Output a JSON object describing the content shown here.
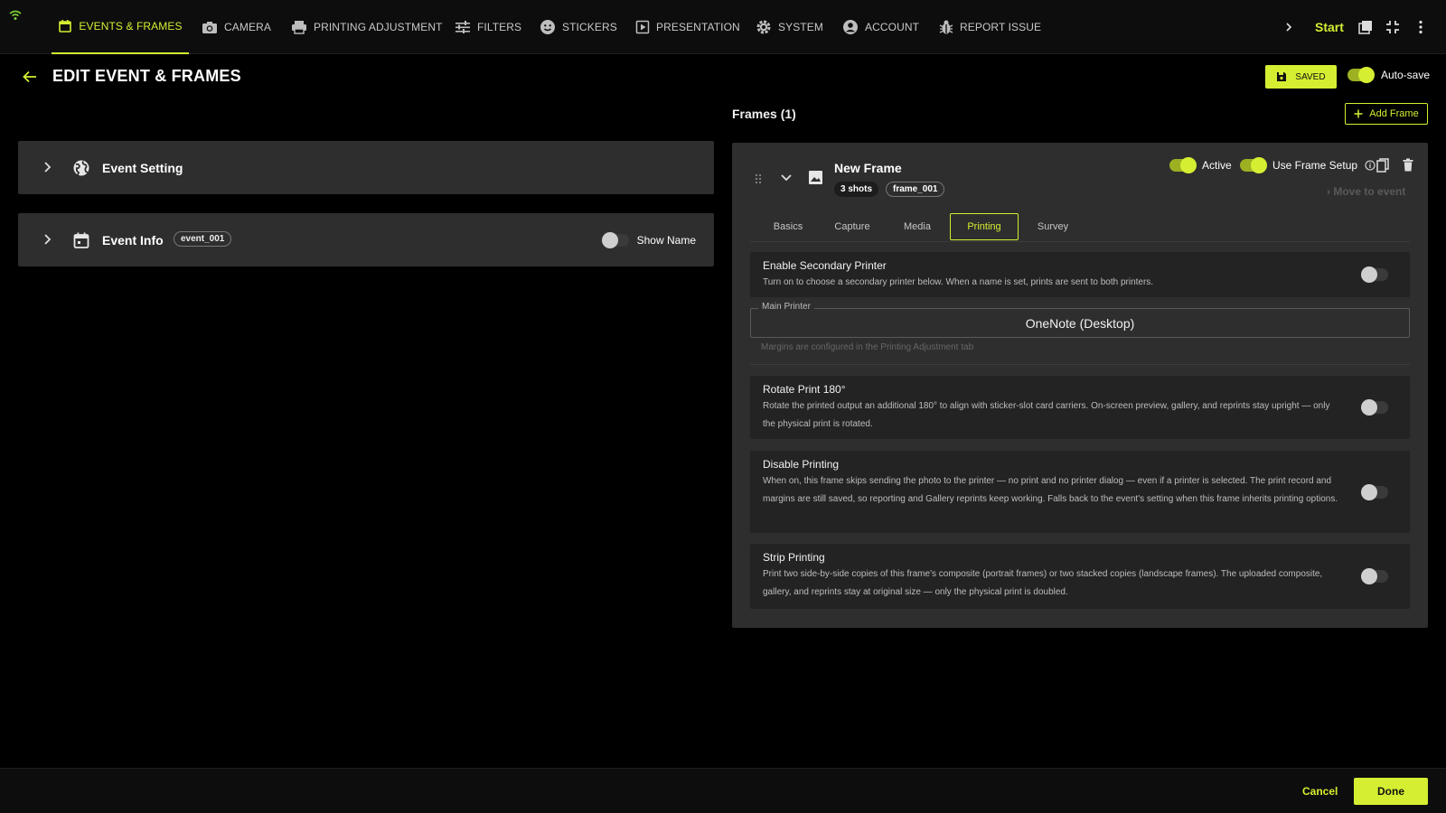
{
  "nav": {
    "items": [
      {
        "label": "EVENTS & FRAMES",
        "icon": "calendar-icon",
        "active": true
      },
      {
        "label": "CAMERA",
        "icon": "camera-icon"
      },
      {
        "label": "PRINTING ADJUSTMENT",
        "icon": "printer-icon"
      },
      {
        "label": "FILTERS",
        "icon": "sliders-icon"
      },
      {
        "label": "STICKERS",
        "icon": "smiley-icon"
      },
      {
        "label": "PRESENTATION",
        "icon": "play-icon"
      },
      {
        "label": "SYSTEM",
        "icon": "gear-icon"
      },
      {
        "label": "ACCOUNT",
        "icon": "user-icon"
      },
      {
        "label": "REPORT ISSUE",
        "icon": "bug-icon"
      }
    ],
    "start_label": "Start",
    "accent": "#d6ee32"
  },
  "header": {
    "title": "EDIT EVENT & FRAMES",
    "saved_label": "SAVED",
    "autosave_label": "Auto-save"
  },
  "panels": {
    "event_setting": {
      "title": "Event Setting"
    },
    "event_info": {
      "title": "Event Info",
      "chip": "event_001",
      "show_name_label": "Show Name"
    }
  },
  "frames": {
    "title": "Frames (1)",
    "add_label": "Add Frame",
    "frame": {
      "name": "New Frame",
      "shots": "3 shots",
      "id": "frame_001",
      "active_label": "Active",
      "use_setup_label": "Use Frame Setup",
      "move_label": "Move to event",
      "tabs": [
        "Basics",
        "Capture",
        "Media",
        "Printing",
        "Survey"
      ],
      "selected_tab": "Printing",
      "settings": {
        "secondary": {
          "title": "Enable Secondary Printer",
          "desc": "Turn on to choose a secondary printer below. When a name is set, prints are sent to both printers."
        },
        "main_printer": {
          "label": "Main Printer",
          "value": "OneNote (Desktop)",
          "help": "Margins are configured in the Printing Adjustment tab"
        },
        "rotate": {
          "title": "Rotate Print 180°",
          "desc": "Rotate the printed output an additional 180° to align with sticker-slot card carriers. On-screen preview, gallery, and reprints stay upright — only the physical print is rotated."
        },
        "disable": {
          "title": "Disable Printing",
          "desc": "When on, this frame skips sending the photo to the printer — no print and no printer dialog — even if a printer is selected. The print record and margins are still saved, so reporting and Gallery reprints keep working. Falls back to the event's setting when this frame inherits printing options."
        },
        "strip": {
          "title": "Strip Printing",
          "desc": "Print two side-by-side copies of this frame's composite (portrait frames) or two stacked copies (landscape frames). The uploaded composite, gallery, and reprints stay at original size — only the physical print is doubled."
        }
      }
    }
  },
  "footer": {
    "cancel_label": "Cancel",
    "done_label": "Done"
  }
}
